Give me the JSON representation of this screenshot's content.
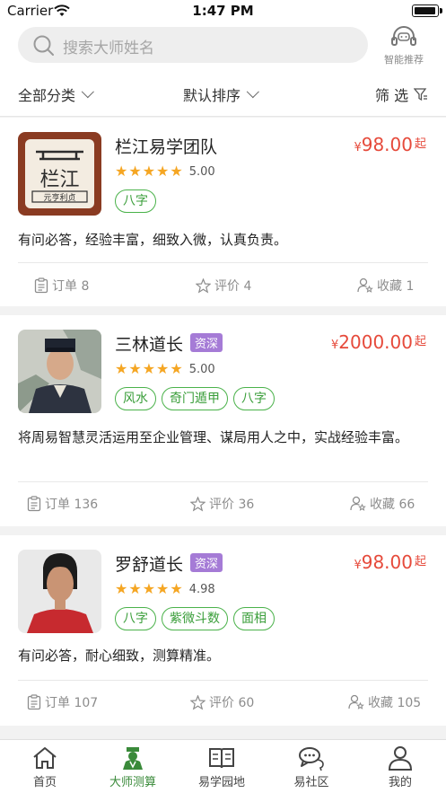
{
  "status_bar": {
    "carrier": "Carrier",
    "time": "1:47 PM"
  },
  "search": {
    "placeholder": "搜索大师姓名",
    "smart_label": "智能推荐"
  },
  "filters": {
    "category": "全部分类",
    "sort": "默认排序",
    "filter": "筛 选"
  },
  "masters": [
    {
      "name": "栏江易学团队",
      "badge": "",
      "price_symbol": "¥",
      "price": "98.00",
      "price_suffix": "起",
      "rating": 5,
      "score": "5.00",
      "tags": [
        "八字"
      ],
      "desc": "有问必答，经验丰富，细致入微，认真负责。",
      "orders": "订单 8",
      "reviews": "评价 4",
      "favorites": "收藏 1",
      "logo_text": "栏江",
      "logo_subtext": "元亨利贞"
    },
    {
      "name": "三林道长",
      "badge": "资深",
      "price_symbol": "¥",
      "price": "2000.00",
      "price_suffix": "起",
      "rating": 5,
      "score": "5.00",
      "tags": [
        "风水",
        "奇门遁甲",
        "八字"
      ],
      "desc": "将周易智慧灵活运用至企业管理、谋局用人之中，实战经验丰富。",
      "orders": "订单 136",
      "reviews": "评价 36",
      "favorites": "收藏 66"
    },
    {
      "name": "罗舒道长",
      "badge": "资深",
      "price_symbol": "¥",
      "price": "98.00",
      "price_suffix": "起",
      "rating": 5,
      "score": "4.98",
      "tags": [
        "八字",
        "紫微斗数",
        "面相"
      ],
      "desc": "有问必答，耐心细致，测算精准。",
      "orders": "订单 107",
      "reviews": "评价 60",
      "favorites": "收藏 105"
    }
  ],
  "tabs": [
    {
      "label": "首页",
      "icon": "home-icon",
      "active": false
    },
    {
      "label": "大师测算",
      "icon": "master-icon",
      "active": true
    },
    {
      "label": "易学园地",
      "icon": "book-icon",
      "active": false
    },
    {
      "label": "易社区",
      "icon": "chat-icon",
      "active": false
    },
    {
      "label": "我的",
      "icon": "person-icon",
      "active": false
    }
  ],
  "colors": {
    "accent_green": "#3a8a3a",
    "price_red": "#e64a3b",
    "star": "#f5a623",
    "badge_purple": "#a57bd6"
  }
}
